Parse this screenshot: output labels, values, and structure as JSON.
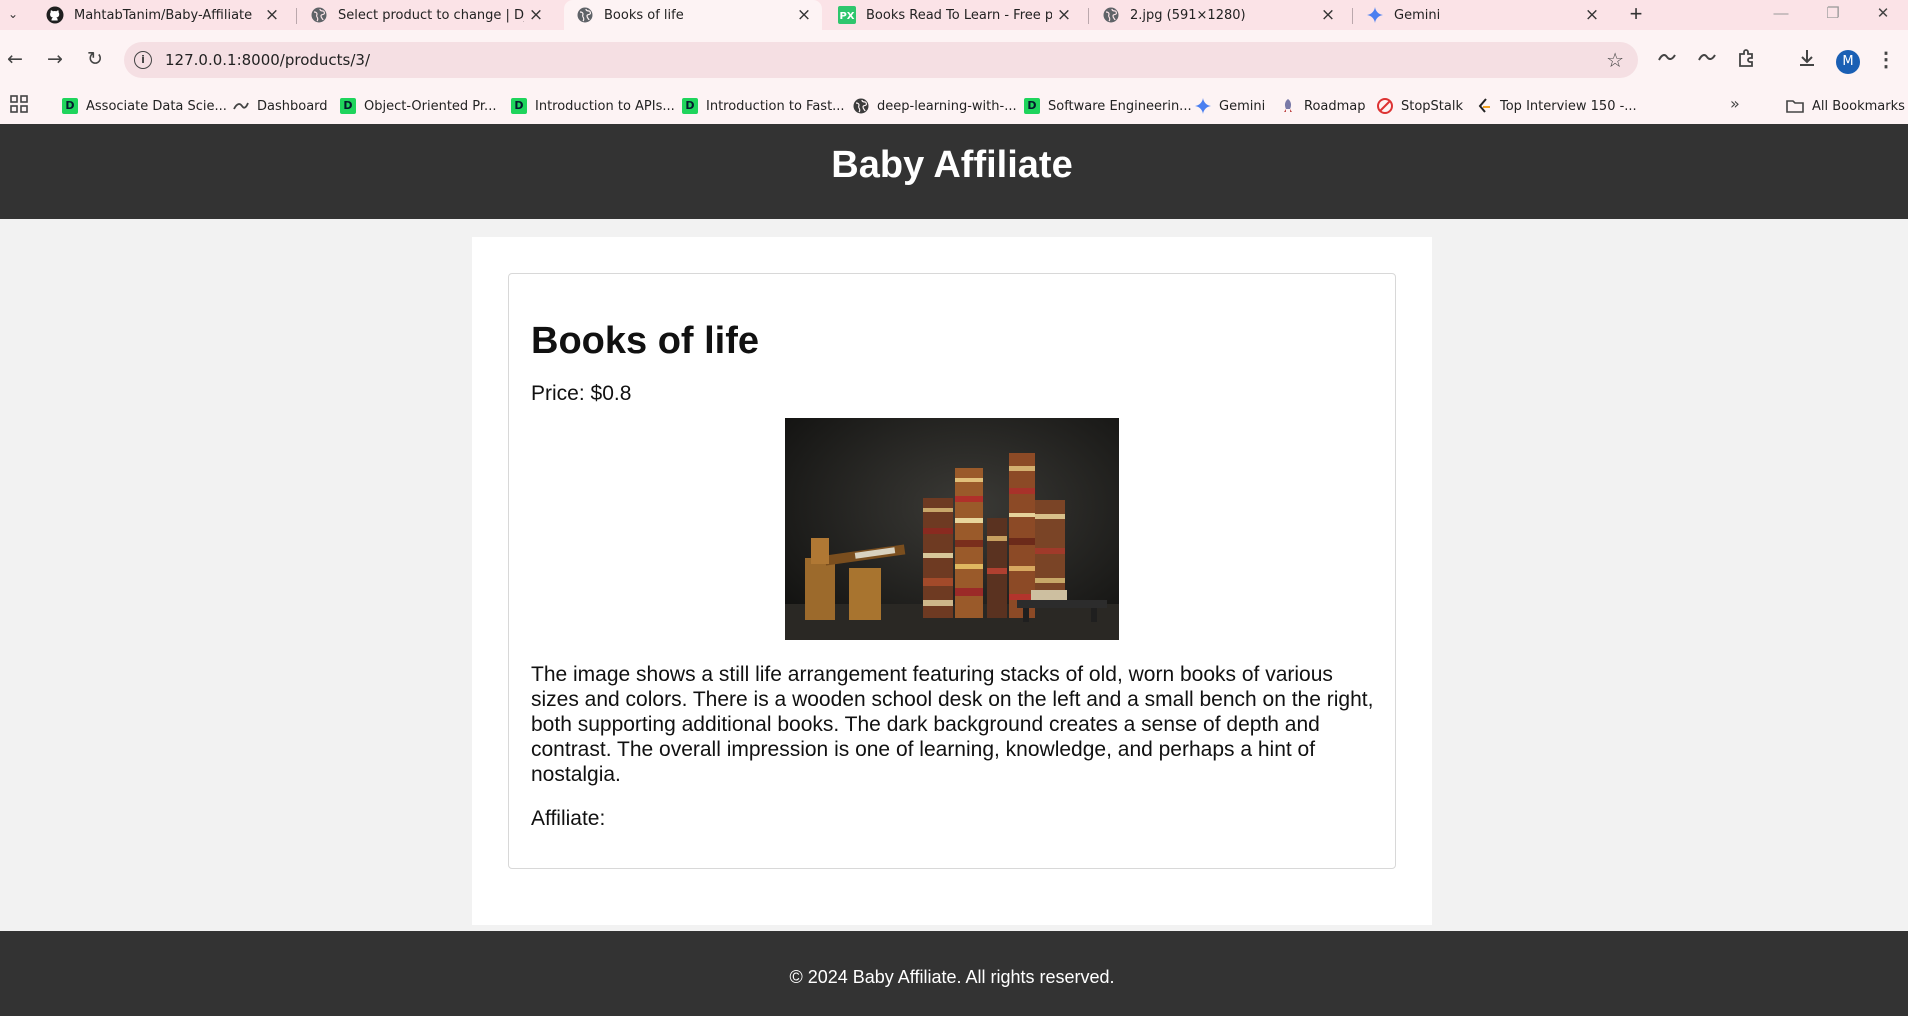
{
  "browser": {
    "tabs": [
      {
        "title": "MahtabTanim/Baby-Affiliate",
        "icon": "github-icon",
        "active": false
      },
      {
        "title": "Select product to change | Djan",
        "icon": "globe-icon",
        "active": false
      },
      {
        "title": "Books of life",
        "icon": "globe-icon",
        "active": true
      },
      {
        "title": "Books Read To Learn - Free pho",
        "icon": "pixabay-icon",
        "active": false
      },
      {
        "title": "2.jpg (591×1280)",
        "icon": "globe-icon",
        "active": false
      },
      {
        "title": "Gemini",
        "icon": "gemini-icon",
        "active": false
      }
    ],
    "url": "127.0.0.1:8000/products/3/",
    "profile_initial": "M",
    "bookmarks": [
      {
        "label": "Associate Data Scie...",
        "icon": "datacamp-icon"
      },
      {
        "label": "Dashboard",
        "icon": "dashboard-icon"
      },
      {
        "label": "Object-Oriented Pr...",
        "icon": "datacamp-icon"
      },
      {
        "label": "Introduction to APIs...",
        "icon": "datacamp-icon"
      },
      {
        "label": "Introduction to Fast...",
        "icon": "datacamp-icon"
      },
      {
        "label": "deep-learning-with-...",
        "icon": "globe-icon"
      },
      {
        "label": "Software Engineerin...",
        "icon": "datacamp-icon"
      },
      {
        "label": "Gemini",
        "icon": "gemini-icon"
      },
      {
        "label": "Roadmap",
        "icon": "rocket-icon"
      },
      {
        "label": "StopStalk",
        "icon": "stopstalk-icon"
      },
      {
        "label": "Top Interview 150 -...",
        "icon": "leetcode-icon"
      }
    ],
    "all_bookmarks_label": "All Bookmarks"
  },
  "site": {
    "title": "Baby Affiliate",
    "footer": "© 2024 Baby Affiliate. All rights reserved."
  },
  "product": {
    "name": "Books of life",
    "price_text": "Price: $0.8",
    "image_subject": "stacks of old books with a wooden school desk and bench on a dark background",
    "description": "The image shows a still life arrangement featuring stacks of old, worn books of various sizes and colors. There is a wooden school desk on the left and a small bench on the right, both supporting additional books. The dark background creates a sense of depth and contrast. The overall impression is one of learning, knowledge, and perhaps a hint of nostalgia.",
    "affiliate_label": "Affiliate:"
  },
  "colors": {
    "header_bg": "#333333",
    "page_bg": "#f2f2f2",
    "tabbar_bg": "#fbe3e7",
    "toolbar_bg": "#fdf3f4"
  }
}
